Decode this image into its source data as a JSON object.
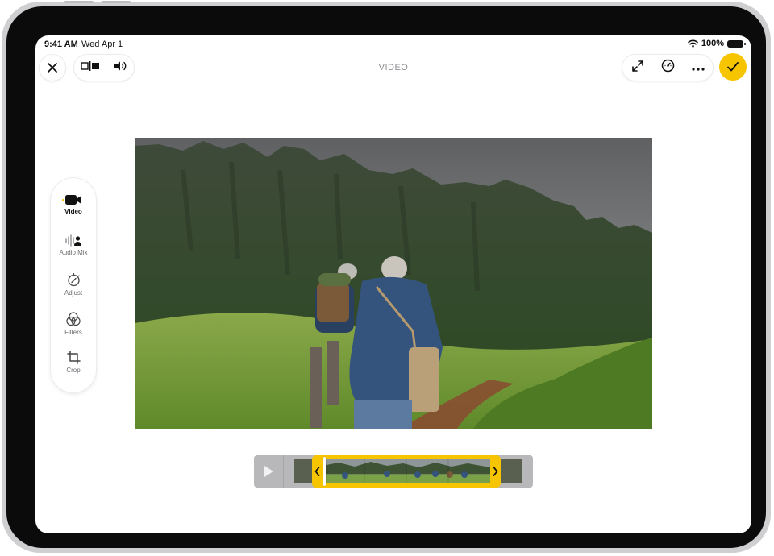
{
  "status_bar": {
    "time": "9:41 AM",
    "date": "Wed Apr 1",
    "battery": "100%"
  },
  "header": {
    "title": "VIDEO"
  },
  "toolbar_left": {
    "close_icon": "close-icon",
    "aspect_icon": "aspect-ratio-icon",
    "volume_icon": "speaker-icon"
  },
  "toolbar_right": {
    "expand_icon": "expand-icon",
    "speed_icon": "speedometer-icon",
    "more_icon": "more-icon",
    "done_icon": "checkmark-icon"
  },
  "tools": [
    {
      "label": "Video",
      "icon": "video-camera-icon",
      "active": true
    },
    {
      "label": "Audio Mix",
      "icon": "audio-mix-icon",
      "active": false
    },
    {
      "label": "Adjust",
      "icon": "adjust-dial-icon",
      "active": false
    },
    {
      "label": "Filters",
      "icon": "filters-icon",
      "active": false
    },
    {
      "label": "Crop",
      "icon": "crop-icon",
      "active": false
    }
  ],
  "colors": {
    "accent": "#f7c500",
    "timeline": "#b8b8bb",
    "text_secondary": "#8e8e93"
  },
  "timeline": {
    "play_icon": "play-icon",
    "trim_left_icon": "chevron-left-icon",
    "trim_right_icon": "chevron-right-icon"
  }
}
